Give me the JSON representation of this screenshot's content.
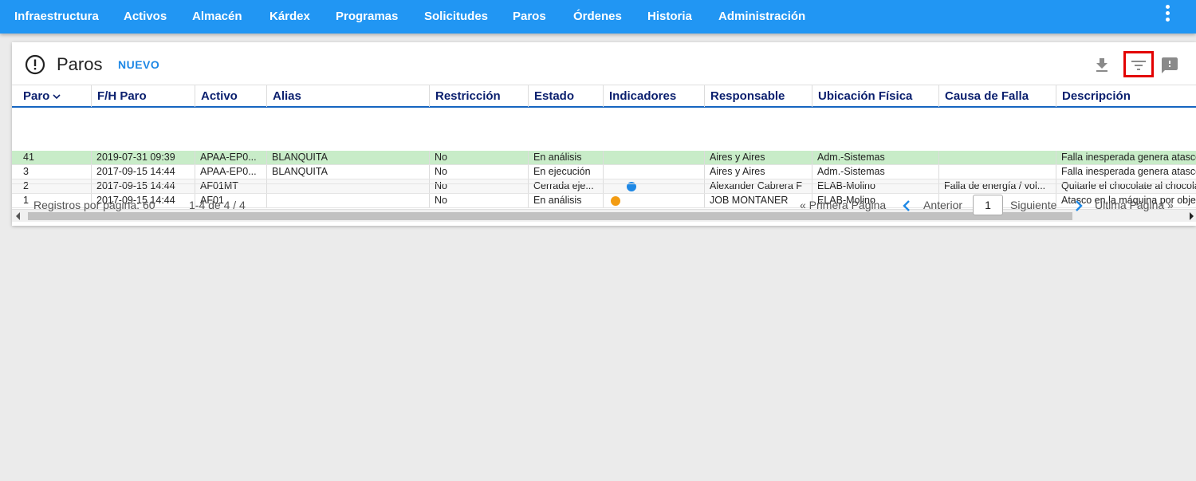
{
  "nav": {
    "items": [
      "Infraestructura",
      "Activos",
      "Almacén",
      "Kárdex",
      "Programas",
      "Solicitudes",
      "Paros",
      "Órdenes",
      "Historia",
      "Administración"
    ]
  },
  "header": {
    "title": "Paros",
    "new_label": "NUEVO"
  },
  "table": {
    "columns": [
      "Paro",
      "F/H Paro",
      "Activo",
      "Alias",
      "Restricción",
      "Estado",
      "Indicadores",
      "Responsable",
      "Ubicación Física",
      "Causa de Falla",
      "Descripción"
    ],
    "rows": [
      {
        "paro": "41",
        "fh": "2019-07-31 09:39",
        "activo": "APAA-EP0...",
        "alias": "BLANQUITA",
        "restriccion": "No",
        "estado": "En análisis",
        "indicador": "",
        "responsable": "Aires y Aires",
        "ubicacion": "Adm.-Sistemas",
        "causa": "",
        "descripcion": "Falla inesperada genera atasco"
      },
      {
        "paro": "3",
        "fh": "2017-09-15 14:44",
        "activo": "APAA-EP0...",
        "alias": "BLANQUITA",
        "restriccion": "No",
        "estado": "En ejecución",
        "indicador": "",
        "responsable": "Aires y Aires",
        "ubicacion": "Adm.-Sistemas",
        "causa": "",
        "descripcion": "Falla inesperada genera atasco"
      },
      {
        "paro": "2",
        "fh": "2017-09-15 14:44",
        "activo": "AF01MT",
        "alias": "",
        "restriccion": "No",
        "estado": "Cerrada eje...",
        "indicador": "blue",
        "responsable": "Alexander Cabrera F",
        "ubicacion": "ELAB-Molino",
        "causa": "Falla de energía / vol...",
        "descripcion": "Quitarle el chocolate al chocolate"
      },
      {
        "paro": "1",
        "fh": "2017-09-15 14:44",
        "activo": "AF01",
        "alias": "",
        "restriccion": "No",
        "estado": "En análisis",
        "indicador": "orange",
        "responsable": "JOB MONTANER",
        "ubicacion": "ELAB-Molino",
        "causa": "",
        "descripcion": "Atasco en la máquina por objeto"
      }
    ]
  },
  "colors": {
    "nav_bg": "#2196f3",
    "selected_row": "#c8ecc8",
    "indicator_blue": "#1e88e5",
    "indicator_orange": "#f39c12",
    "accent": "#1e88e5"
  },
  "footer": {
    "per_page": "Registros por página: 60",
    "range": "1-4 de 4 / 4",
    "first": "« Primera Página",
    "prev": "Anterior",
    "page": "1",
    "next": "Siguiente",
    "last": "Última Página »"
  }
}
